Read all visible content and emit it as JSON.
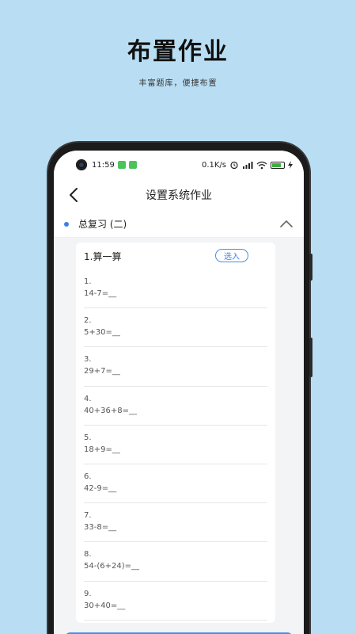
{
  "promo": {
    "title": "布置作业",
    "subtitle": "丰富题库，便捷布置"
  },
  "status_bar": {
    "time": "11:59",
    "net_speed": "0.1K/s"
  },
  "navbar": {
    "title": "设置系统作业"
  },
  "section": {
    "title": "总复习 (二)"
  },
  "card": {
    "title": "1.算一算",
    "select_label": "选入",
    "questions": [
      {
        "num": "1.",
        "expr": "14-7=__"
      },
      {
        "num": "2.",
        "expr": "5+30=__"
      },
      {
        "num": "3.",
        "expr": "29+7=__"
      },
      {
        "num": "4.",
        "expr": "40+36+8=__"
      },
      {
        "num": "5.",
        "expr": "18+9=__"
      },
      {
        "num": "6.",
        "expr": "42-9=__"
      },
      {
        "num": "7.",
        "expr": "33-8=__"
      },
      {
        "num": "8.",
        "expr": "54-(6+24)=__"
      },
      {
        "num": "9.",
        "expr": "30+40=__"
      }
    ]
  },
  "colors": {
    "background": "#b9def3",
    "accent": "#3d7fe6"
  }
}
